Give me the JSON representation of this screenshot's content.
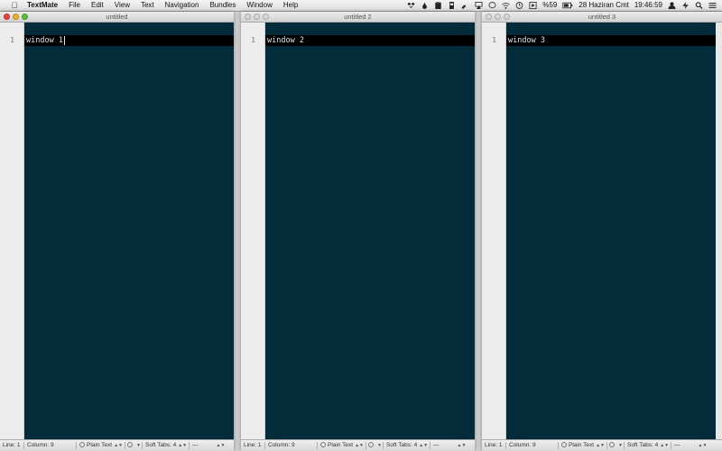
{
  "menubar": {
    "app": "TextMate",
    "items": [
      "File",
      "Edit",
      "View",
      "Text",
      "Navigation",
      "Bundles",
      "Window",
      "Help"
    ],
    "battery": "%59",
    "date": "28 Haziran Cmt",
    "time": "19:46:59",
    "status_icons": [
      "dropbox-icon",
      "droplet-icon",
      "clipboard-icon",
      "battery-monitor-icon",
      "wrench-icon",
      "airplay-icon",
      "chat-icon",
      "wifi-icon",
      "timemachine-icon",
      "play-icon",
      "battery-icon",
      "user-icon",
      "bolt-icon",
      "search-icon",
      "list-icon"
    ]
  },
  "windows": [
    {
      "title": "untitled",
      "active": true,
      "line_number": "1",
      "content": "window 1",
      "status": {
        "line": "Line: 1",
        "column": "Column: 9",
        "grammar": "Plain Text",
        "tabs_label": "Soft Tabs:",
        "tabs_value": "4",
        "symbol": "—"
      }
    },
    {
      "title": "untitled 2",
      "active": false,
      "line_number": "1",
      "content": "window 2",
      "status": {
        "line": "Line: 1",
        "column": "Column: 9",
        "grammar": "Plain Text",
        "tabs_label": "Soft Tabs:",
        "tabs_value": "4",
        "symbol": "—"
      }
    },
    {
      "title": "untitled 3",
      "active": false,
      "line_number": "1",
      "content": "window 3",
      "status": {
        "line": "Line: 1",
        "column": "Column: 9",
        "grammar": "Plain Text",
        "tabs_label": "Soft Tabs:",
        "tabs_value": "4",
        "symbol": "—"
      }
    }
  ],
  "colors": {
    "editor_bg": "#042b3a",
    "current_line": "#000000",
    "text": "#d8e2e6"
  }
}
